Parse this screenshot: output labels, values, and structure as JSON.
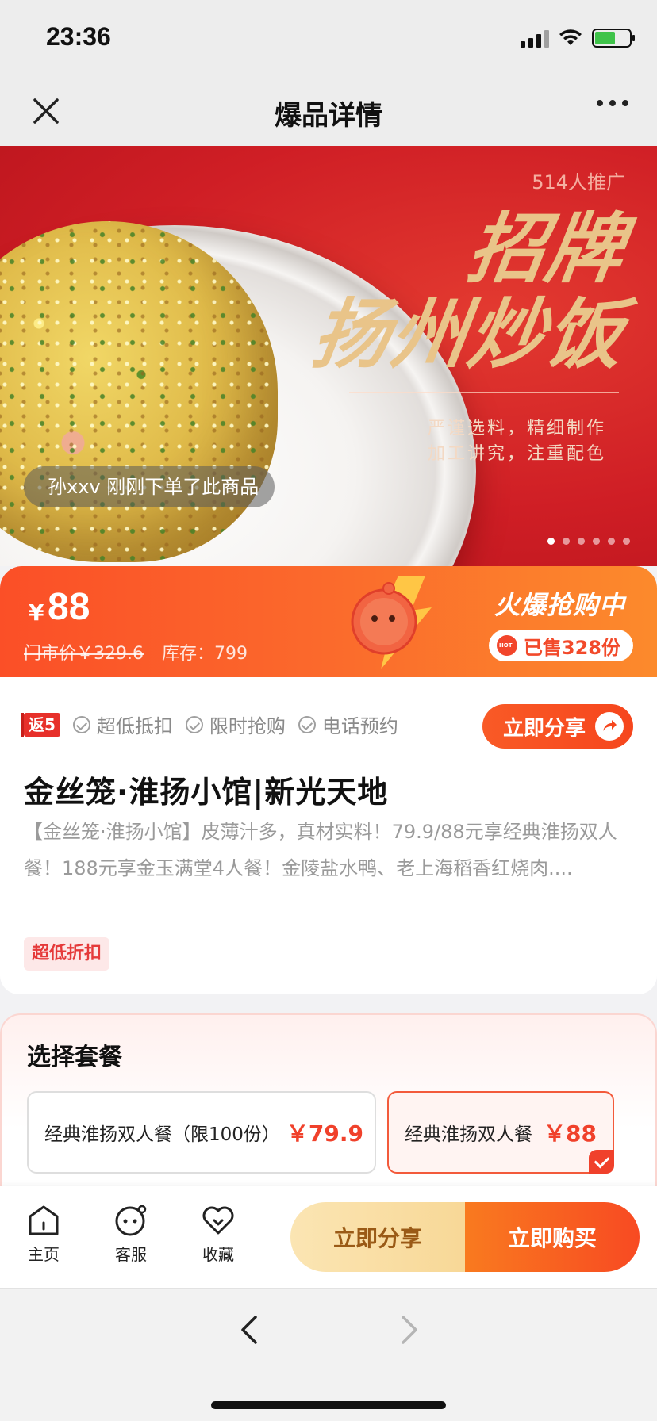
{
  "status_bar": {
    "time": "23:36"
  },
  "nav": {
    "title": "爆品详情"
  },
  "hero": {
    "promo_count": "514人推广",
    "title_line1": "招牌",
    "title_line2": "扬州炒饭",
    "subtitle_line1": "严谨选料，精细制作",
    "subtitle_line2": "加工讲究，注重配色",
    "order_toast": "孙xxv 刚刚下单了此商品",
    "carousel_count": 6,
    "carousel_active": 0
  },
  "price_bar": {
    "currency": "¥",
    "price": "88",
    "original_price": "门市价￥329.6",
    "stock": "库存：799",
    "hot_title": "火爆抢购中",
    "sold": "已售328份"
  },
  "info": {
    "rebate_badge": "返5",
    "tags": [
      "超低抵扣",
      "限时抢购",
      "电话预约"
    ],
    "share_label": "立即分享",
    "store_title": "金丝笼·淮扬小馆|新光天地",
    "description": "【金丝笼·淮扬小馆】皮薄汁多，真材实料！79.9/88元享经典淮扬双人餐！188元享金玉满堂4人餐！金陵盐水鸭、老上海稻香红烧肉....",
    "discount_tag": "超低折扣"
  },
  "package": {
    "title": "选择套餐",
    "options": [
      {
        "name": "经典淮扬双人餐（限100份）",
        "price": "￥79.9",
        "selected": false
      },
      {
        "name": "经典淮扬双人餐",
        "price": "￥88",
        "selected": true
      }
    ]
  },
  "action_bar": {
    "home": "主页",
    "service": "客服",
    "favorite": "收藏",
    "share": "立即分享",
    "buy": "立即购买"
  },
  "colors": {
    "brand_red": "#f0412b",
    "price_bar_orange": "#fb5a2a",
    "hero_red": "#cf1e25",
    "gold_text": "#e9c489"
  }
}
